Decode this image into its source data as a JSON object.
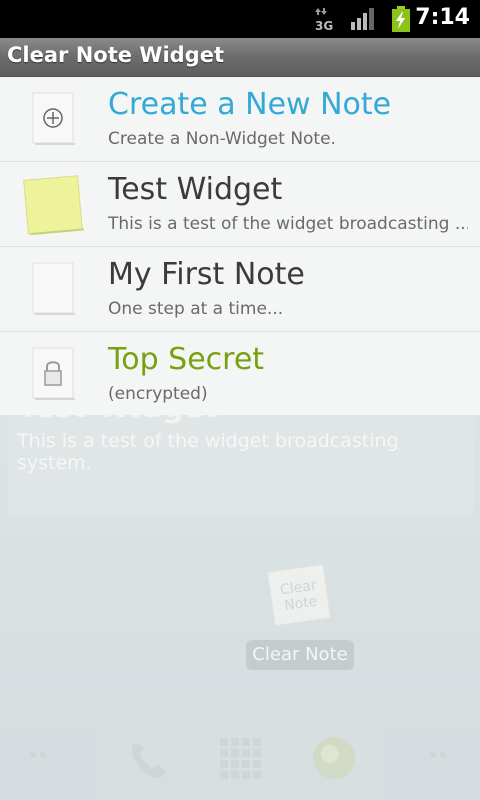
{
  "status_bar": {
    "network": "3G",
    "time": "7:14"
  },
  "app": {
    "title": "Clear Note Widget"
  },
  "notes": [
    {
      "title": "Create a New Note",
      "subtitle": "Create a Non-Widget Note.",
      "title_color": "#33a9d6",
      "thumb": "plus-icon"
    },
    {
      "title": "Test Widget",
      "subtitle": "This is a test of the widget broadcasting ...",
      "title_color": "#3b3b3b",
      "thumb": "sticky-note-yellow"
    },
    {
      "title": "My First Note",
      "subtitle": "One step at a time...",
      "title_color": "#3b3b3b",
      "thumb": "blank-note"
    },
    {
      "title": "Top Secret",
      "subtitle": "(encrypted)",
      "title_color": "#7aa012",
      "thumb": "lock-icon"
    }
  ],
  "background": {
    "widget_title": "Test Widget",
    "widget_text": "This is a test of the widget broadcasting system.",
    "app_label": "Clear Note",
    "app_icon_text": "Clear Note",
    "dock_icons": [
      "phone-icon",
      "apps-grid-icon",
      "browser-globe-icon"
    ]
  }
}
